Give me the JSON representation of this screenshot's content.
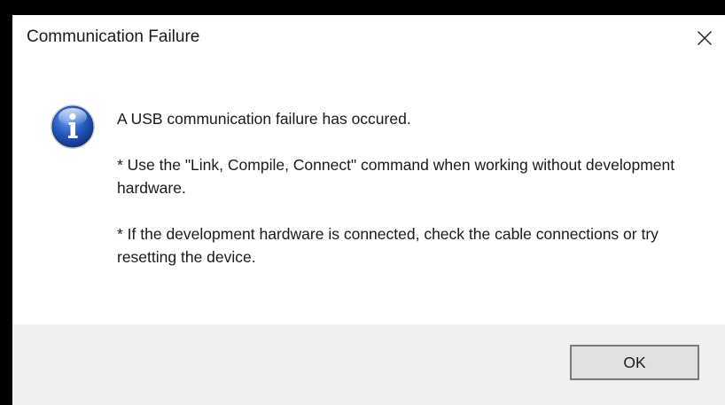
{
  "window": {
    "title": "Communication Failure",
    "close_icon": "close-icon"
  },
  "message": {
    "icon": "info-icon",
    "lines": [
      "A USB communication failure has occured.",
      "* Use the \"Link, Compile, Connect\" command when working without development hardware.",
      "* If the development hardware is connected, check the cable connections or try resetting the device."
    ]
  },
  "buttons": {
    "ok_label": "OK"
  },
  "colors": {
    "backdrop": "#000000",
    "dialog_bg": "#ffffff",
    "footer_bg": "#f0f0f0",
    "button_bg": "#e1e1e1",
    "button_border": "#7a7a7a",
    "icon_blue": "#1d4fae"
  }
}
